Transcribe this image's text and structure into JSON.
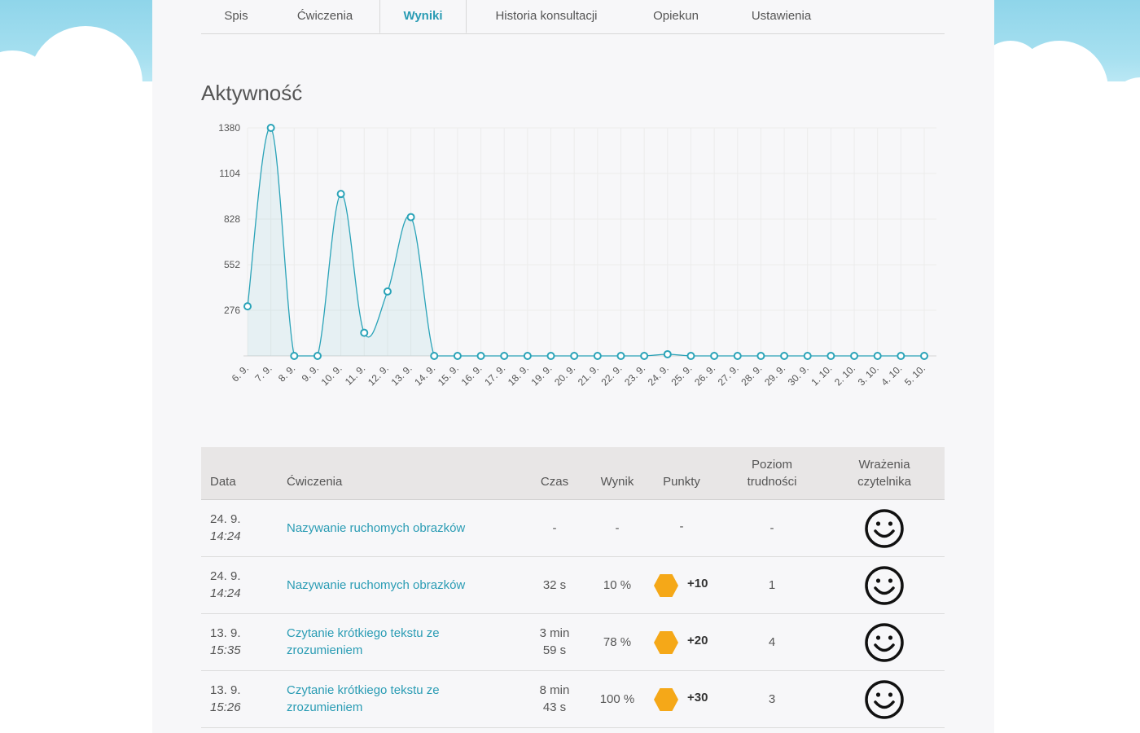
{
  "tabs": [
    {
      "label": "Spis",
      "active": false
    },
    {
      "label": "Ćwiczenia",
      "active": false
    },
    {
      "label": "Wyniki",
      "active": true
    },
    {
      "label": "Historia konsultacji",
      "active": false
    },
    {
      "label": "Opiekun",
      "active": false
    },
    {
      "label": "Ustawienia",
      "active": false
    }
  ],
  "title": "Aktywność",
  "colors": {
    "accent": "#2a9cb4",
    "line": "#2aa3b8",
    "hex": "#f5a818",
    "header_bg": "#e8e6e6"
  },
  "chart_data": {
    "type": "line",
    "title": "",
    "xlabel": "",
    "ylabel": "",
    "ylim": [
      0,
      1380
    ],
    "yticks": [
      276,
      552,
      828,
      1104,
      1380
    ],
    "x": [
      "6. 9.",
      "7. 9.",
      "8. 9.",
      "9. 9.",
      "10. 9.",
      "11. 9.",
      "12. 9.",
      "13. 9.",
      "14. 9.",
      "15. 9.",
      "16. 9.",
      "17. 9.",
      "18. 9.",
      "19. 9.",
      "20. 9.",
      "21. 9.",
      "22. 9.",
      "23. 9.",
      "24. 9.",
      "25. 9.",
      "26. 9.",
      "27. 9.",
      "28. 9.",
      "29. 9.",
      "30. 9.",
      "1. 10.",
      "2. 10.",
      "3. 10.",
      "4. 10.",
      "5. 10."
    ],
    "series": [
      {
        "values": [
          300,
          1380,
          0,
          0,
          980,
          140,
          390,
          840,
          0,
          0,
          0,
          0,
          0,
          0,
          0,
          0,
          0,
          0,
          10,
          0,
          0,
          0,
          0,
          0,
          0,
          0,
          0,
          0,
          0,
          0
        ]
      }
    ],
    "grid": true
  },
  "table": {
    "headers": {
      "date": "Data",
      "exercise": "Ćwiczenia",
      "time": "Czas",
      "score": "Wynik",
      "points": "Punkty",
      "level_1": "Poziom",
      "level_2": "trudności",
      "impression_1": "Wrażenia",
      "impression_2": "czytelnika"
    },
    "rows": [
      {
        "date": "24. 9.",
        "time_of_day": "14:24",
        "exercise_1": "Nazywanie ruchomych obrazków",
        "exercise_2": "",
        "time_1": "-",
        "time_2": "",
        "score": "-",
        "points": "-",
        "has_hex": false,
        "level": "-"
      },
      {
        "date": "24. 9.",
        "time_of_day": "14:24",
        "exercise_1": "Nazywanie ruchomych obrazków",
        "exercise_2": "",
        "time_1": "32 s",
        "time_2": "",
        "score": "10 %",
        "points": "+10",
        "has_hex": true,
        "level": "1"
      },
      {
        "date": "13. 9.",
        "time_of_day": "15:35",
        "exercise_1": "Czytanie krótkiego tekstu ze",
        "exercise_2": "zrozumieniem",
        "time_1": "3 min",
        "time_2": "59 s",
        "score": "78 %",
        "points": "+20",
        "has_hex": true,
        "level": "4"
      },
      {
        "date": "13. 9.",
        "time_of_day": "15:26",
        "exercise_1": "Czytanie krótkiego tekstu ze",
        "exercise_2": "zrozumieniem",
        "time_1": "8 min",
        "time_2": "43 s",
        "score": "100 %",
        "points": "+30",
        "has_hex": true,
        "level": "3"
      }
    ]
  }
}
